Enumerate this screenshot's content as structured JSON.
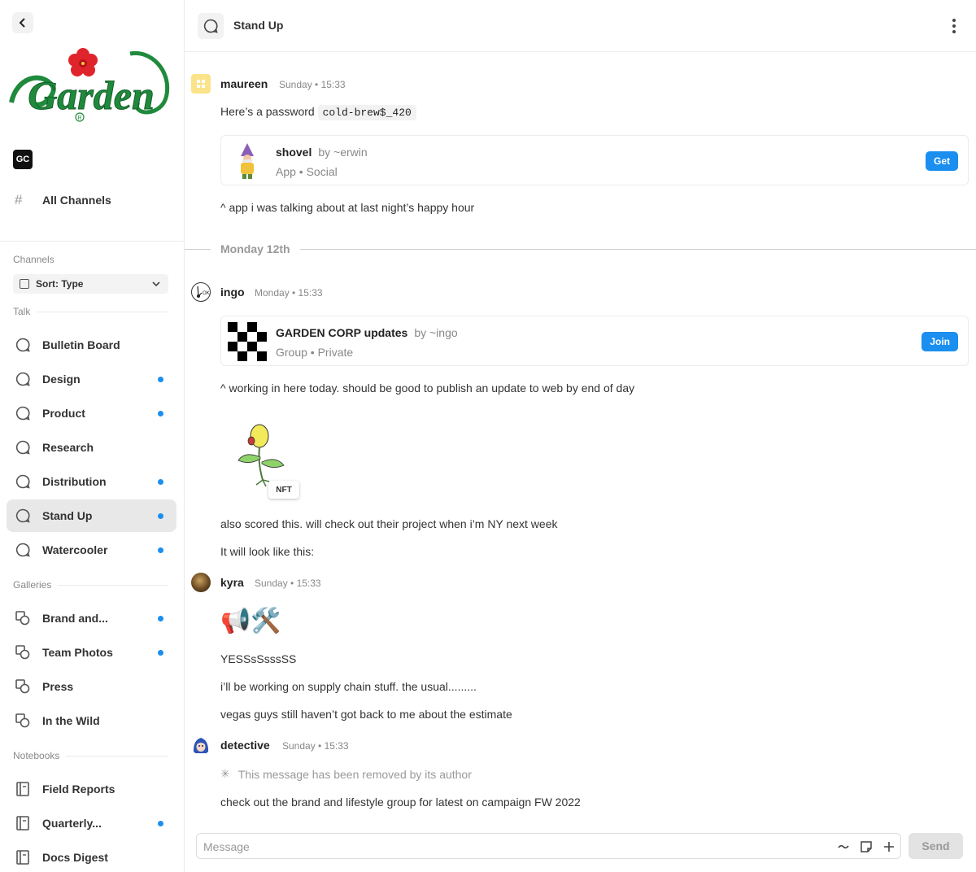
{
  "sidebar": {
    "workspace_badge": "GC",
    "all_channels_label": "All Channels",
    "channels_section": "Channels",
    "sort_label": "Sort: Type",
    "talk_section": "Talk",
    "talk_items": [
      {
        "label": "Bulletin Board",
        "unread": false,
        "active": false
      },
      {
        "label": "Design",
        "unread": true,
        "active": false
      },
      {
        "label": "Product",
        "unread": true,
        "active": false
      },
      {
        "label": "Research",
        "unread": false,
        "active": false
      },
      {
        "label": "Distribution",
        "unread": true,
        "active": false
      },
      {
        "label": "Stand Up",
        "unread": true,
        "active": true
      },
      {
        "label": "Watercooler",
        "unread": true,
        "active": false
      }
    ],
    "galleries_section": "Galleries",
    "gallery_items": [
      {
        "label": "Brand and...",
        "unread": true
      },
      {
        "label": "Team Photos",
        "unread": true
      },
      {
        "label": "Press",
        "unread": false
      },
      {
        "label": "In the Wild",
        "unread": false
      }
    ],
    "notebooks_section": "Notebooks",
    "notebook_items": [
      {
        "label": "Field Reports",
        "unread": false
      },
      {
        "label": "Quarterly...",
        "unread": true
      },
      {
        "label": "Docs Digest",
        "unread": false
      }
    ]
  },
  "header": {
    "title": "Stand Up"
  },
  "messages": {
    "m1": {
      "author": "maureen",
      "time": "Sunday • 15:33",
      "text_prefix": "Here’s a password",
      "code": "cold-brew$_420",
      "card": {
        "title": "shovel",
        "by": "by ~erwin",
        "subtitle": "App • Social",
        "button": "Get"
      },
      "followup": "^ app i was talking about at last night’s happy hour"
    },
    "divider": "Monday 12th",
    "m2": {
      "author": "ingo",
      "time": "Monday • 15:33",
      "card": {
        "title": "GARDEN CORP updates",
        "by": "by ~ingo",
        "subtitle": "Group • Private",
        "button": "Join"
      },
      "text1": "^ working in here today. should be good to publish an update to web by end of day",
      "nft_tag": "NFT",
      "text2": "also scored this. will check out their project when i’m NY next week",
      "text3": "It will look like this:"
    },
    "m3": {
      "author": "kyra",
      "time": "Sunday • 15:33",
      "emoji": "📢🛠️",
      "text1": "YESSsSsssSS",
      "text2": "i’ll be working on supply chain stuff. the usual.........",
      "text3": "vegas guys still haven’t got back to me about the estimate"
    },
    "m4": {
      "author": "detective",
      "time": "Sunday • 15:33",
      "removed": "This message has been removed by its author",
      "text": "check out the brand and lifestyle group for latest on campaign FW 2022"
    }
  },
  "composer": {
    "placeholder": "Message",
    "send_label": "Send"
  },
  "colors": {
    "accent": "#1a8ff0",
    "logo_green": "#1f8a3c",
    "logo_red": "#e0242b"
  }
}
